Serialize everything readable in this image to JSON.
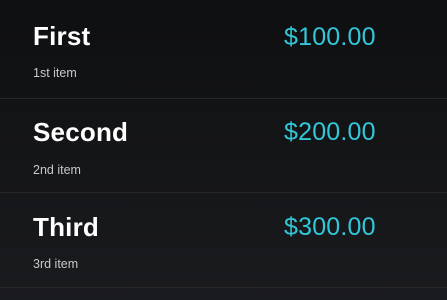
{
  "items": [
    {
      "title": "First",
      "subtitle": "1st item",
      "price": "$100.00"
    },
    {
      "title": "Second",
      "subtitle": "2nd item",
      "price": "$200.00"
    },
    {
      "title": "Third",
      "subtitle": "3rd item",
      "price": "$300.00"
    }
  ],
  "colors": {
    "background": "#111214",
    "title": "#ffffff",
    "subtitle": "#c8c8c8",
    "price": "#33c7d8",
    "divider": "#26272a"
  }
}
